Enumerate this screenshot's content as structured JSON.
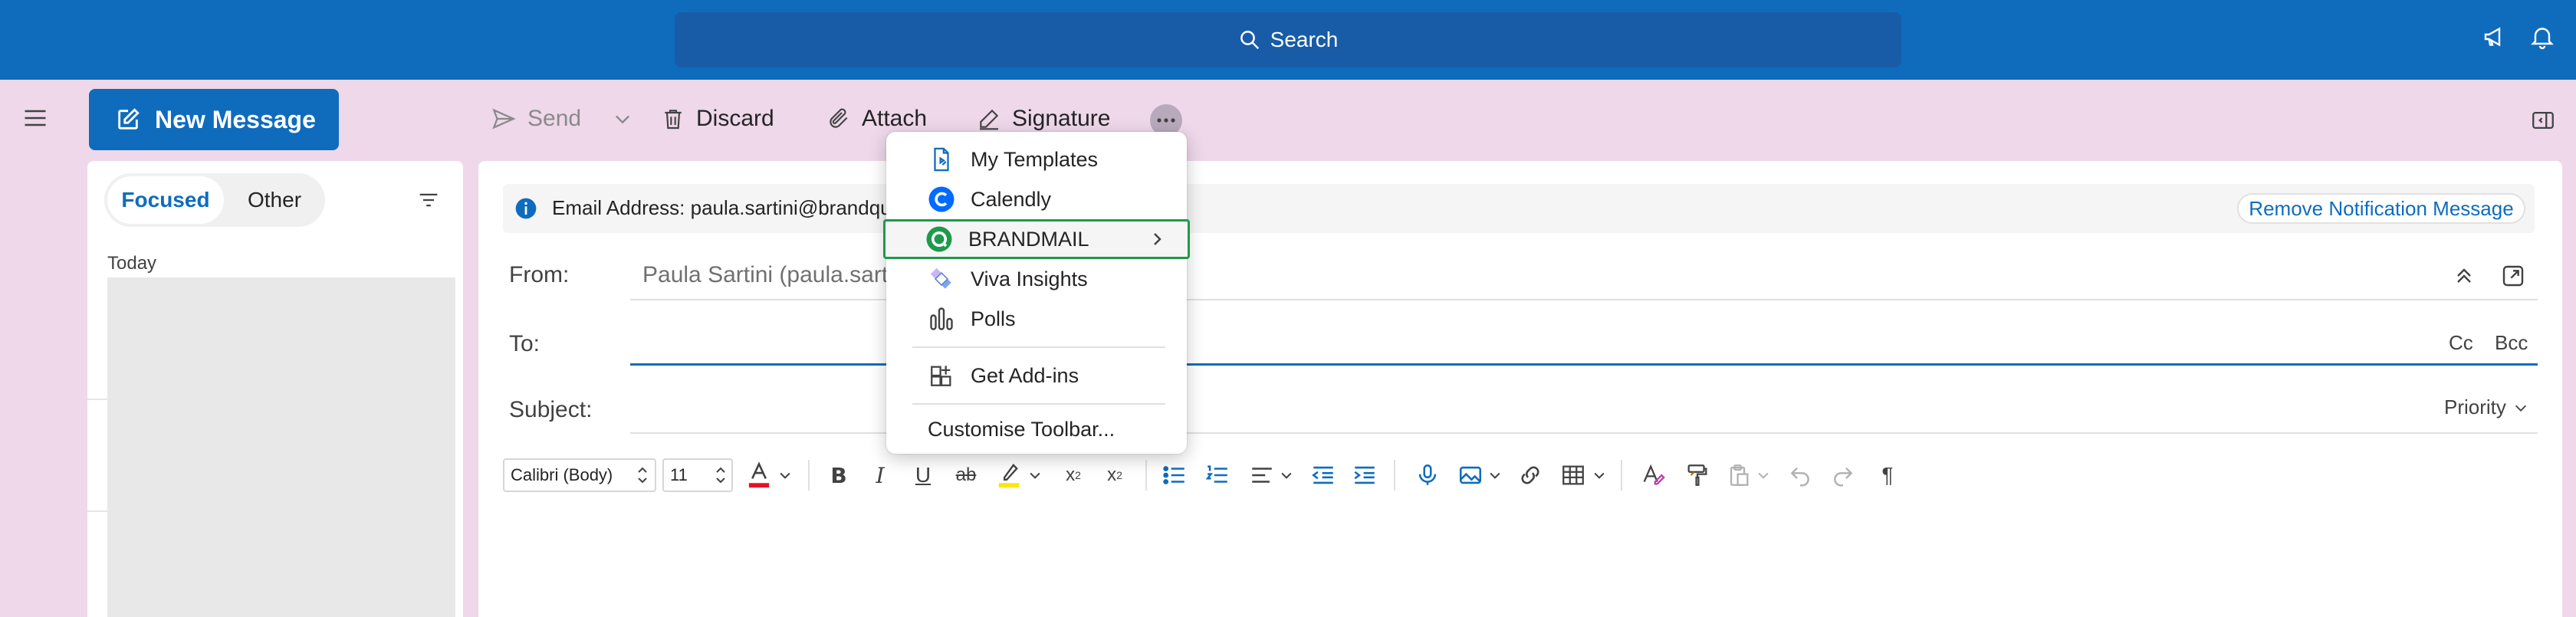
{
  "search": {
    "label": "Search"
  },
  "nav": {
    "new_message": "New Message"
  },
  "toolbar": {
    "send": "Send",
    "discard": "Discard",
    "attach": "Attach",
    "signature": "Signature"
  },
  "list": {
    "tabs": [
      {
        "label": "Focused"
      },
      {
        "label": "Other"
      }
    ],
    "group_today": "Today"
  },
  "notification": {
    "text": "Email Address: paula.sartini@brandqua",
    "remove_button": "Remove Notification Message"
  },
  "compose": {
    "from_label": "From:",
    "from_value": "Paula Sartini (paula.sart",
    "to_label": "To:",
    "subject_label": "Subject:",
    "cc": "Cc",
    "bcc": "Bcc",
    "priority": "Priority"
  },
  "format": {
    "font": "Calibri (Body)",
    "size": "11"
  },
  "menu": {
    "items": [
      {
        "label": "My Templates",
        "icon": "templates-icon"
      },
      {
        "label": "Calendly",
        "icon": "calendly-icon"
      },
      {
        "label": "BRANDMAIL",
        "icon": "brandmail-icon"
      },
      {
        "label": "Viva Insights",
        "icon": "viva-insights-icon"
      },
      {
        "label": "Polls",
        "icon": "polls-icon"
      },
      {
        "label": "Get Add-ins",
        "icon": "add-ins-icon"
      },
      {
        "label": "Customise Toolbar...",
        "icon": ""
      }
    ]
  },
  "colors": {
    "brand": "#0f6cbd",
    "background": "#eed8ea",
    "highlight_border": "#1f9a4a",
    "font_color_red": "#e81123",
    "highlight_yellow": "#ffe600"
  }
}
